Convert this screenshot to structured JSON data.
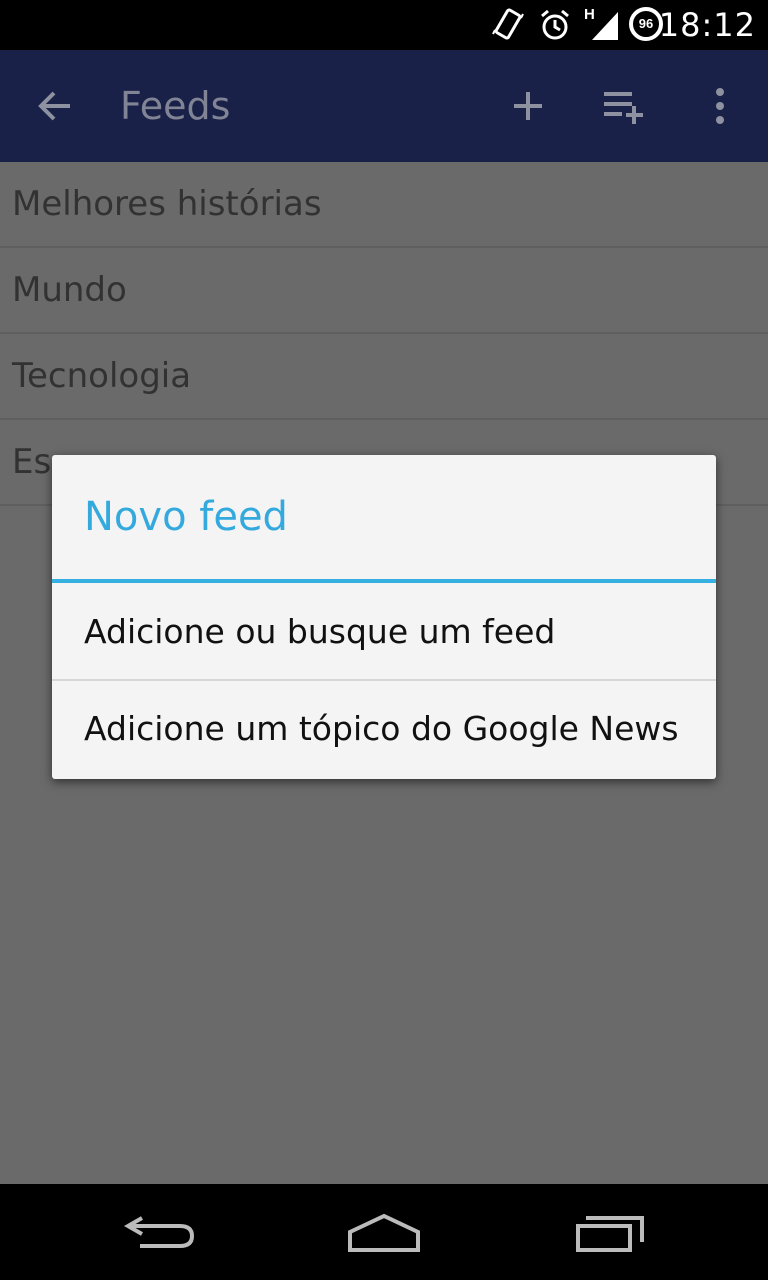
{
  "status_bar": {
    "time": "18:12",
    "battery_level": "96",
    "network_type": "H",
    "icons": [
      "vibrate-icon",
      "alarm-icon",
      "signal-icon",
      "battery-icon"
    ]
  },
  "app_bar": {
    "title": "Feeds",
    "icons": [
      "back-arrow-icon",
      "add-icon",
      "playlist-add-icon",
      "overflow-menu-icon"
    ],
    "background": "#1a2148"
  },
  "feed_list": {
    "items": [
      {
        "label": "Melhores histórias"
      },
      {
        "label": "Mundo"
      },
      {
        "label": "Tecnologia"
      },
      {
        "label": "Es"
      }
    ]
  },
  "dialog": {
    "title": "Novo feed",
    "accent": "#33a9de",
    "options": [
      {
        "label": "Adicione ou busque um feed"
      },
      {
        "label": "Adicione um tópico do Google News"
      }
    ]
  },
  "nav_bar": {
    "icons": [
      "back-icon",
      "home-icon",
      "recents-icon"
    ]
  }
}
